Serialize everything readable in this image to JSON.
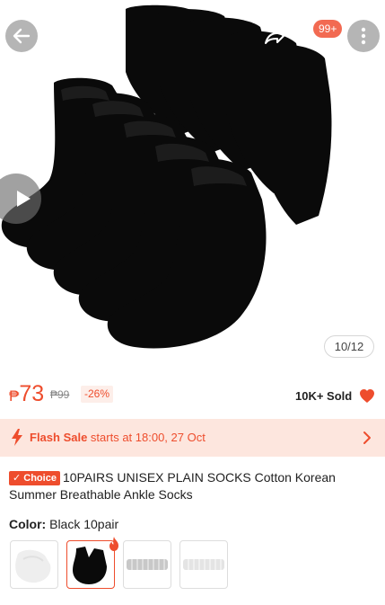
{
  "header": {
    "cart_badge": "99+"
  },
  "gallery": {
    "page_counter": "10/12",
    "current_image": 10,
    "total_images": 12
  },
  "price": {
    "currency": "₱",
    "current": "73",
    "original": "₱99",
    "discount": "-26%",
    "sold": "10K+ Sold"
  },
  "flash_sale": {
    "label": "Flash Sale",
    "text": " starts at 18:00, 27 Oct"
  },
  "product": {
    "badge": "✓ Choice",
    "title": "10PAIRS UNISEX PLAIN SOCKS Cotton Korean Summer Breathable Ankle Socks"
  },
  "color": {
    "label": "Color:",
    "value": "Black 10pair",
    "options": [
      "White",
      "Black 10pair",
      "Gray",
      "White 10pair"
    ],
    "selected_index": 1
  },
  "colors": {
    "accent": "#ee4d2d",
    "flash_bg": "#fde6de"
  }
}
